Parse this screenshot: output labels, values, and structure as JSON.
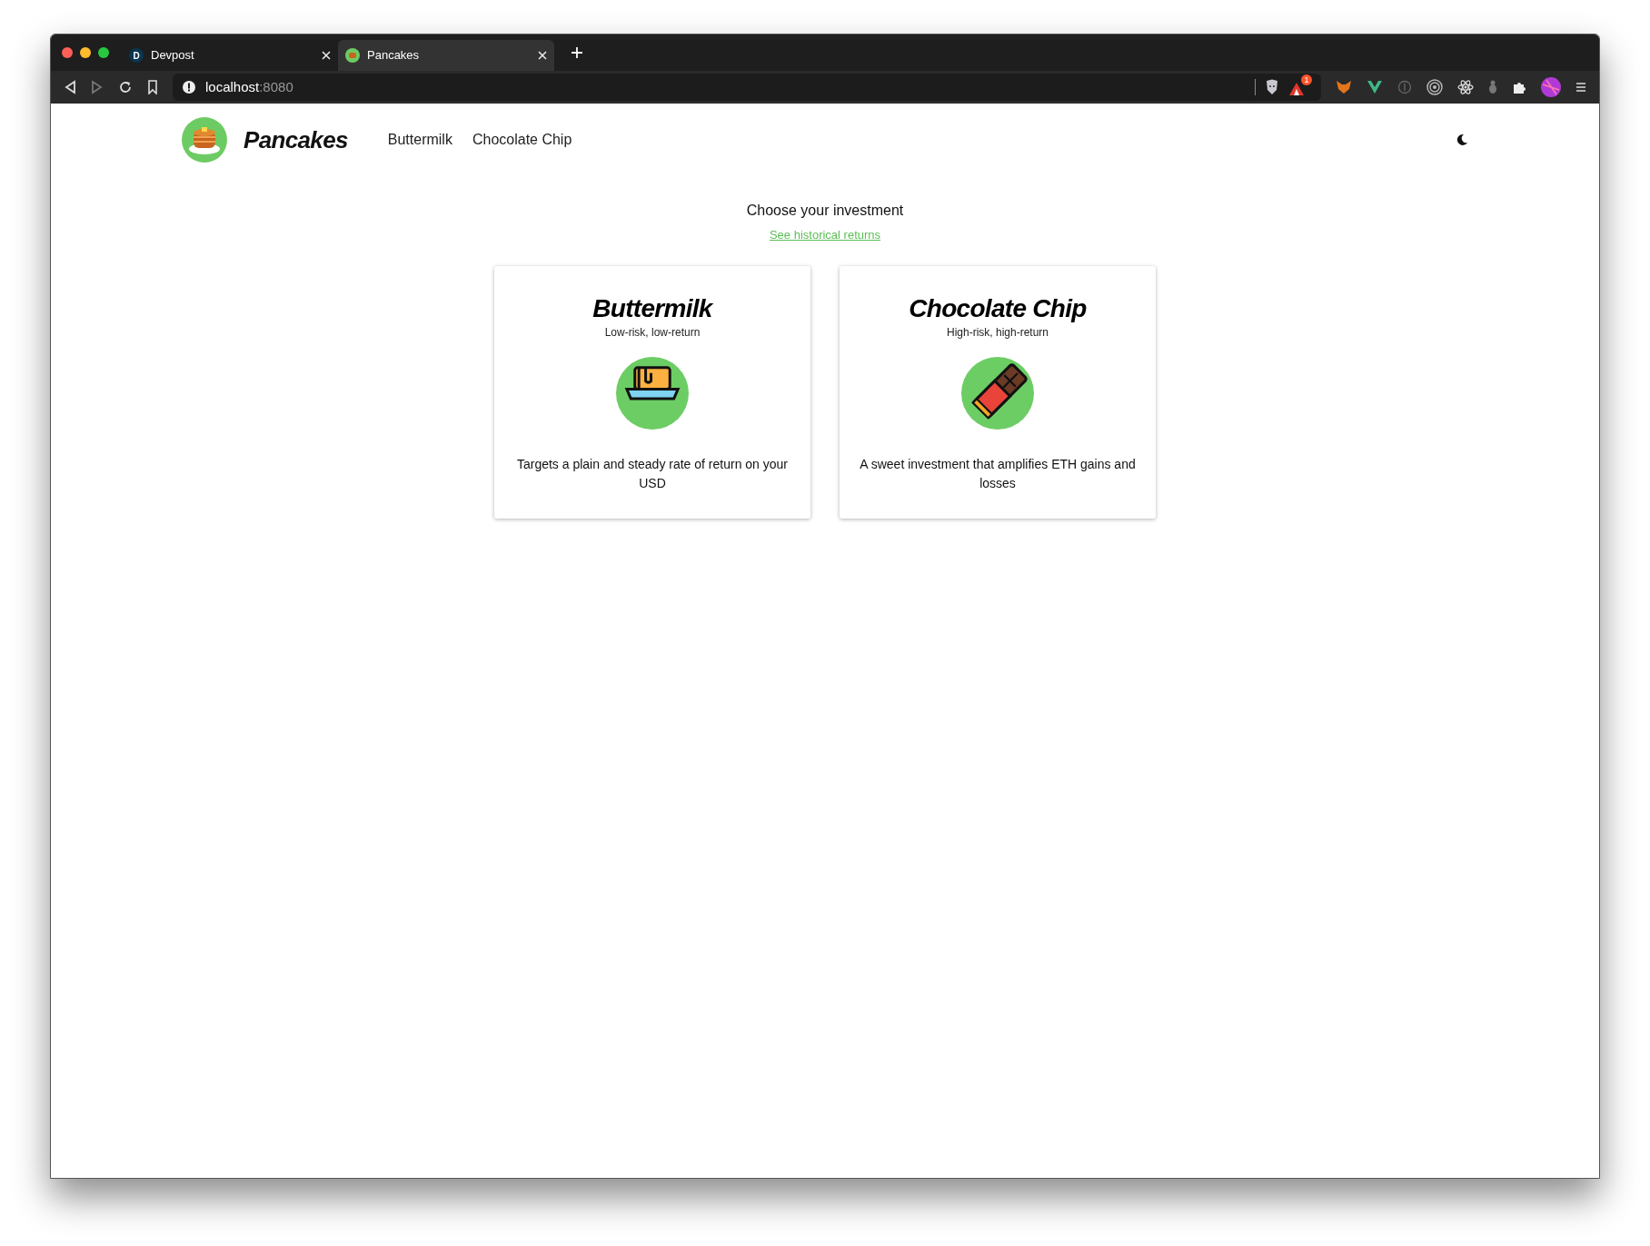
{
  "browser": {
    "tabs": [
      {
        "title": "Devpost",
        "favicon_letter": "D",
        "selected": false
      },
      {
        "title": "Pancakes",
        "selected": true
      }
    ],
    "url_host": "localhost",
    "url_port": ":8080",
    "extension_badge": "1"
  },
  "header": {
    "brand": "Pancakes",
    "nav": [
      "Buttermilk",
      "Chocolate Chip"
    ]
  },
  "heading": "Choose your investment",
  "link": "See historical returns",
  "cards": [
    {
      "kind": "butter",
      "title": "Buttermilk",
      "subtitle": "Low-risk, low-return",
      "description": "Targets a plain and steady rate of return on your USD"
    },
    {
      "kind": "chocolate",
      "title": "Chocolate Chip",
      "subtitle": "High-risk, high-return",
      "description": "A sweet investment that amplifies ETH gains and losses"
    }
  ]
}
